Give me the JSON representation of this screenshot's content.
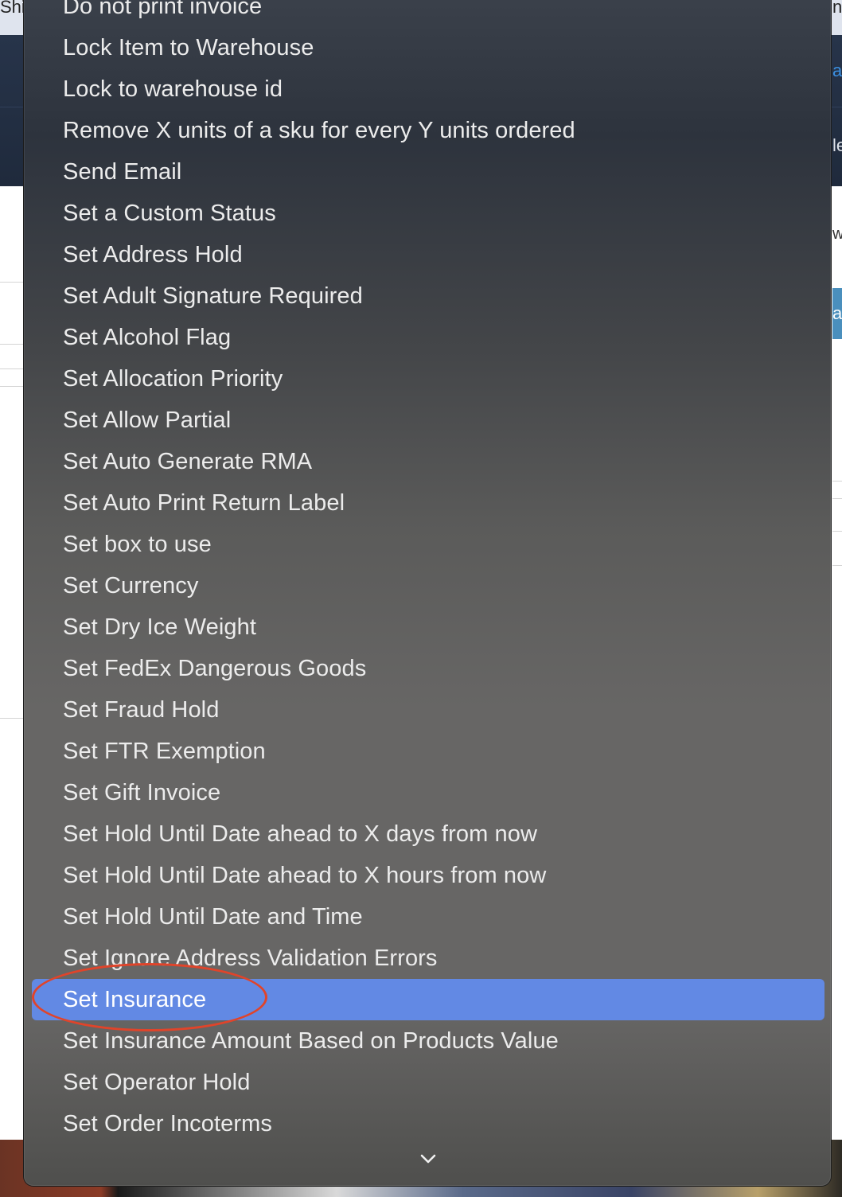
{
  "background": {
    "topbar_left_text": "Shi",
    "topbar_right_text": "n",
    "nav_link_fragment": "a",
    "nav_text_fragment": "le",
    "content_text_fragment": "w",
    "button_fragment": "a"
  },
  "menu": {
    "items": [
      {
        "label": "Do not print invoice"
      },
      {
        "label": "Lock Item to Warehouse"
      },
      {
        "label": "Lock to warehouse id"
      },
      {
        "label": "Remove X units of a sku for every Y units ordered"
      },
      {
        "label": "Send Email"
      },
      {
        "label": "Set a Custom Status"
      },
      {
        "label": "Set Address Hold"
      },
      {
        "label": "Set Adult Signature Required"
      },
      {
        "label": "Set Alcohol Flag"
      },
      {
        "label": "Set Allocation Priority"
      },
      {
        "label": "Set Allow Partial"
      },
      {
        "label": "Set Auto Generate RMA"
      },
      {
        "label": "Set Auto Print Return Label"
      },
      {
        "label": "Set box to use"
      },
      {
        "label": "Set Currency"
      },
      {
        "label": "Set Dry Ice Weight"
      },
      {
        "label": "Set FedEx Dangerous Goods"
      },
      {
        "label": "Set Fraud Hold"
      },
      {
        "label": "Set FTR Exemption"
      },
      {
        "label": "Set Gift Invoice"
      },
      {
        "label": "Set Hold Until Date ahead to X days from now"
      },
      {
        "label": "Set Hold Until Date ahead to X hours from now"
      },
      {
        "label": "Set Hold Until Date and Time"
      },
      {
        "label": "Set Ignore Address Validation Errors"
      },
      {
        "label": "Set Insurance",
        "selected": true
      },
      {
        "label": "Set Insurance Amount Based on Products Value"
      },
      {
        "label": "Set Operator Hold"
      },
      {
        "label": "Set Order Incoterms"
      }
    ],
    "selected_label": "Set Insurance",
    "scroll_indicator_icon": "chevron-down-icon",
    "highlight_color": "#6289e4",
    "annotation_color": "#e0442a"
  }
}
